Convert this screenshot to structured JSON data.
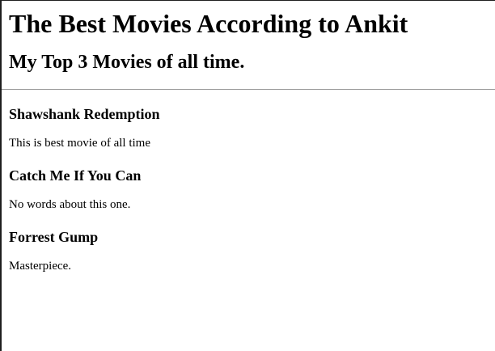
{
  "page": {
    "title": "The Best Movies According to Ankit",
    "subtitle": "My Top 3 Movies of all time."
  },
  "movies": [
    {
      "title": "Shawshank Redemption",
      "description": "This is best movie of all time"
    },
    {
      "title": "Catch Me If You Can",
      "description": "No words about this one."
    },
    {
      "title": "Forrest Gump",
      "description": "Masterpiece."
    }
  ]
}
